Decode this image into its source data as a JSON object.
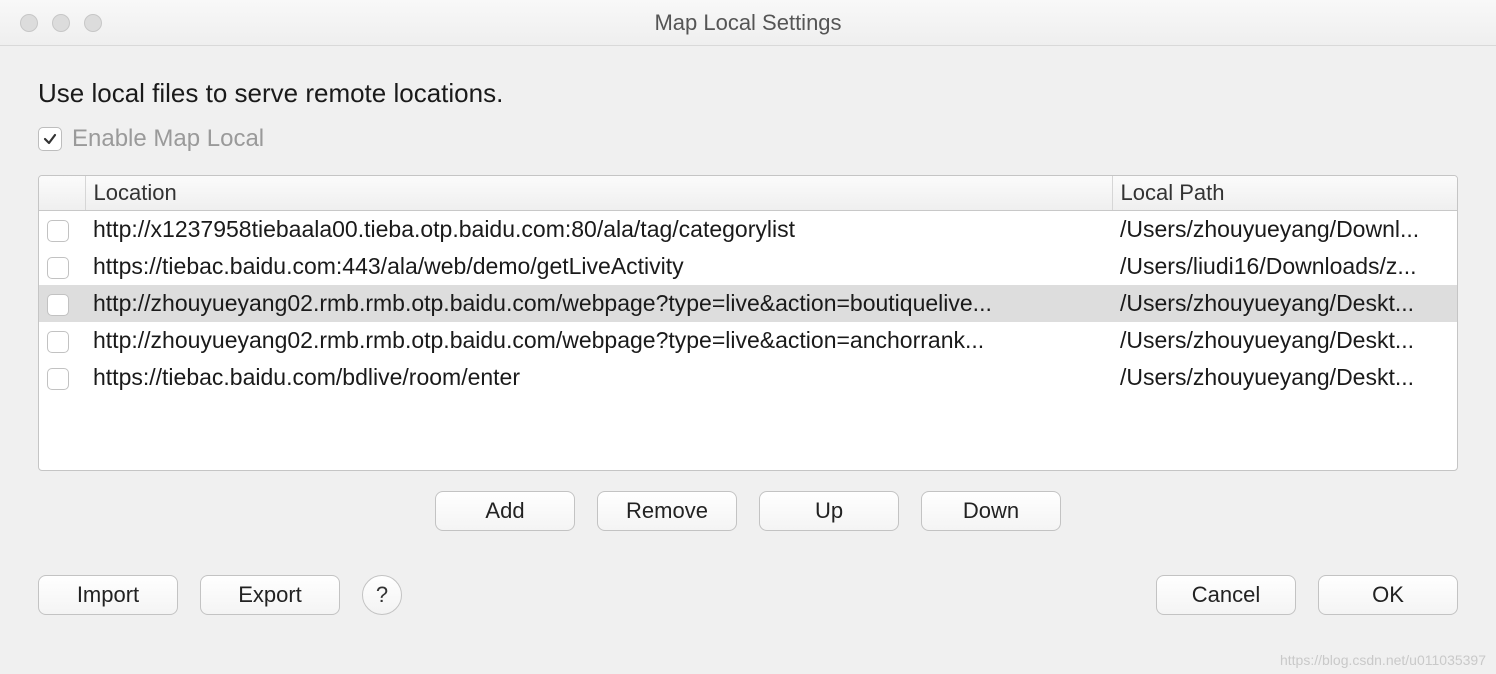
{
  "window": {
    "title": "Map Local Settings"
  },
  "description": "Use local files to serve remote locations.",
  "enable": {
    "label": "Enable Map Local",
    "checked": true
  },
  "table": {
    "headers": {
      "checkbox": "",
      "location": "Location",
      "local_path": "Local Path"
    },
    "rows": [
      {
        "location": "http://x1237958tiebaala00.tieba.otp.baidu.com:80/ala/tag/categorylist",
        "local_path": "/Users/zhouyueyang/Downl...",
        "selected": false
      },
      {
        "location": "https://tiebac.baidu.com:443/ala/web/demo/getLiveActivity",
        "local_path": "/Users/liudi16/Downloads/z...",
        "selected": false
      },
      {
        "location": "http://zhouyueyang02.rmb.rmb.otp.baidu.com/webpage?type=live&action=boutiquelive...",
        "local_path": "/Users/zhouyueyang/Deskt...",
        "selected": true
      },
      {
        "location": "http://zhouyueyang02.rmb.rmb.otp.baidu.com/webpage?type=live&action=anchorrank...",
        "local_path": "/Users/zhouyueyang/Deskt...",
        "selected": false
      },
      {
        "location": "https://tiebac.baidu.com/bdlive/room/enter",
        "local_path": "/Users/zhouyueyang/Deskt...",
        "selected": false
      }
    ]
  },
  "buttons": {
    "add": "Add",
    "remove": "Remove",
    "up": "Up",
    "down": "Down",
    "import": "Import",
    "export": "Export",
    "help": "?",
    "cancel": "Cancel",
    "ok": "OK"
  },
  "watermark": "https://blog.csdn.net/u011035397"
}
